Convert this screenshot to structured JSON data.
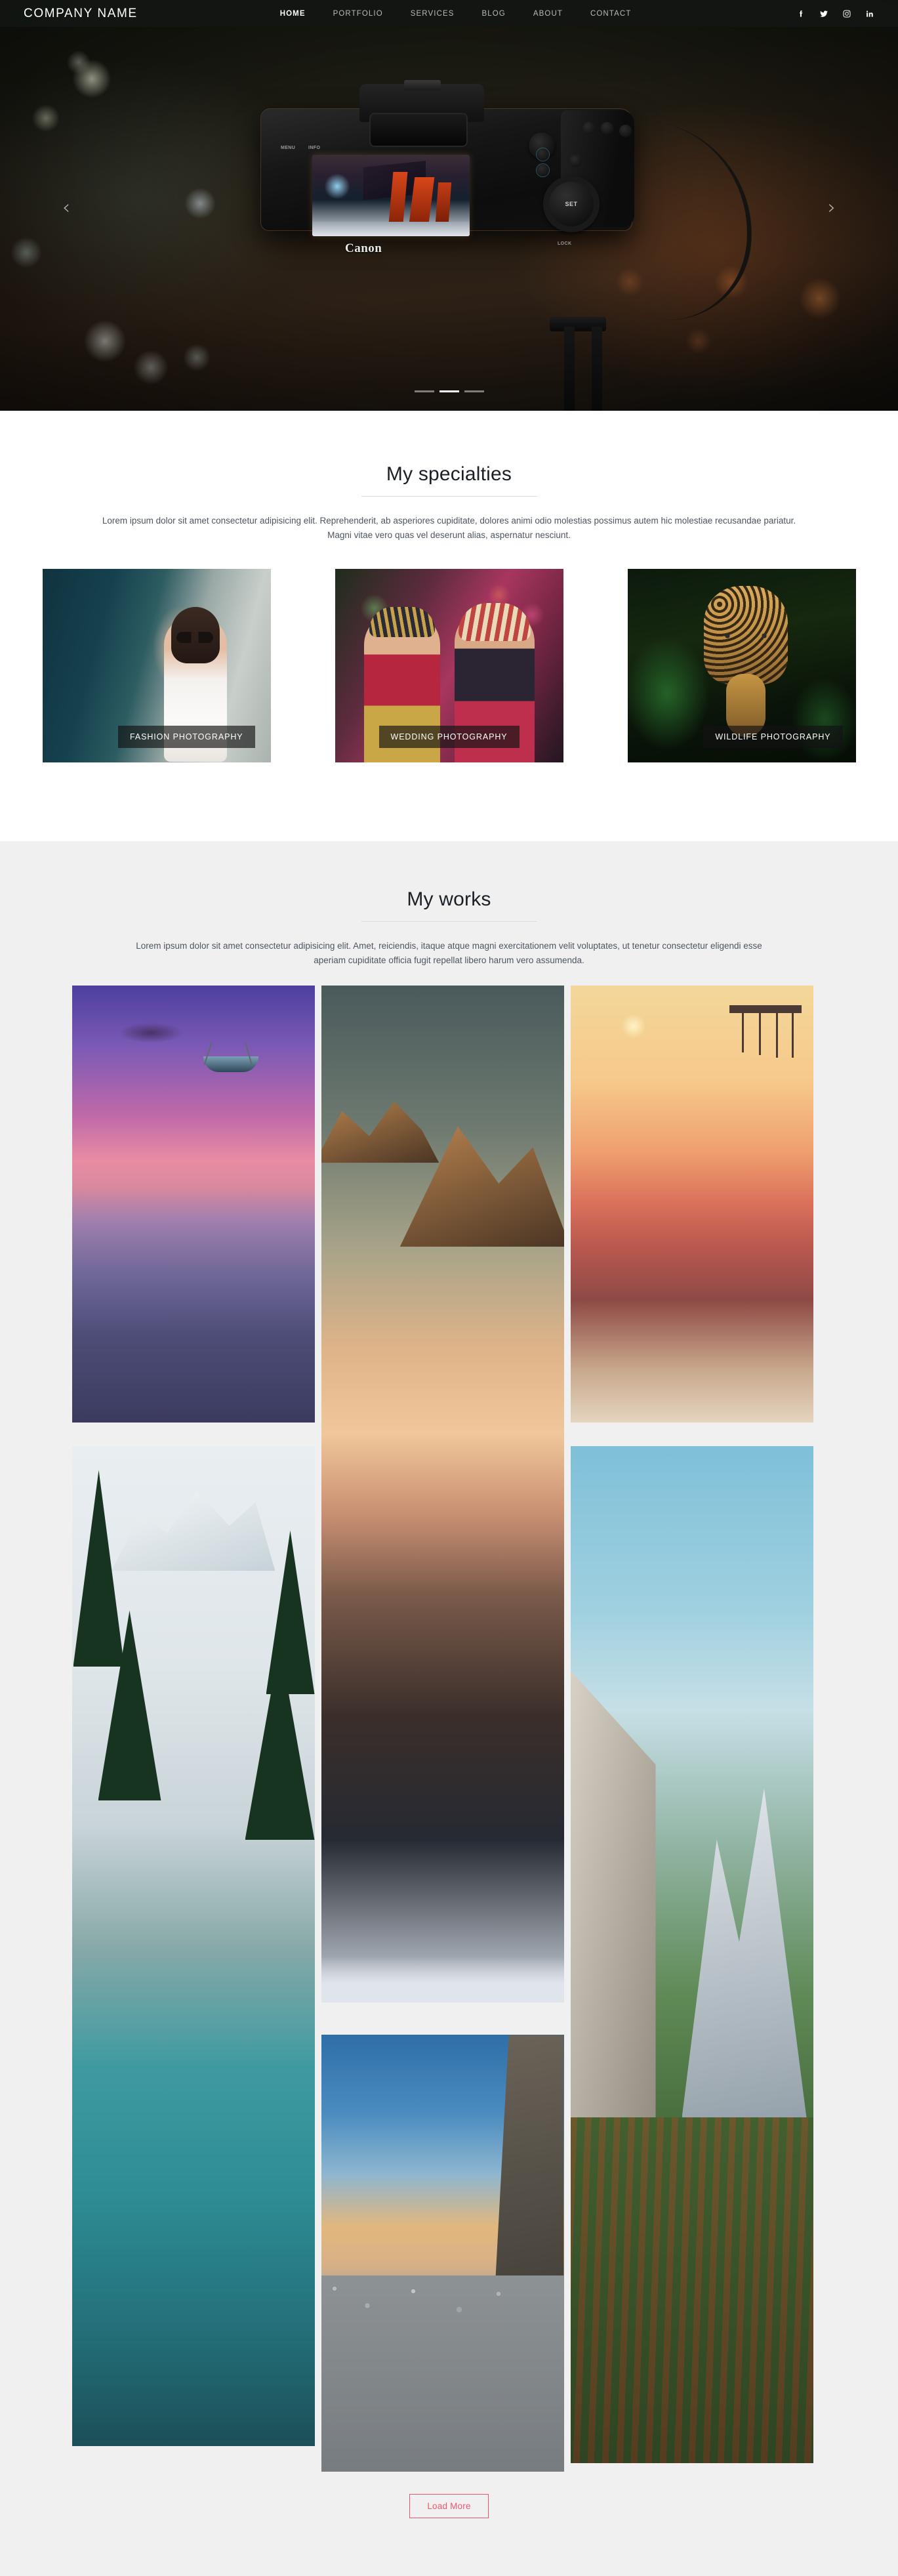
{
  "header": {
    "logo": "COMPANY NAME",
    "nav": [
      {
        "label": "HOME",
        "active": true
      },
      {
        "label": "PORTFOLIO",
        "active": false
      },
      {
        "label": "SERVICES",
        "active": false
      },
      {
        "label": "BLOG",
        "active": false
      },
      {
        "label": "ABOUT",
        "active": false
      },
      {
        "label": "CONTACT",
        "active": false
      }
    ],
    "social": [
      {
        "name": "facebook-icon"
      },
      {
        "name": "twitter-icon"
      },
      {
        "name": "instagram-icon"
      },
      {
        "name": "linkedin-icon"
      }
    ]
  },
  "hero": {
    "prev_label": "‹",
    "next_label": "›",
    "slide_count": 3,
    "active_slide": 2,
    "camera_brand": "Canon",
    "camera_labels": {
      "menu": "MENU",
      "info": "INFO",
      "set": "SET",
      "lock": "LOCK"
    }
  },
  "specialties": {
    "title": "My specialties",
    "description": "Lorem ipsum dolor sit amet consectetur adipisicing elit. Reprehenderit, ab asperiores cupiditate, dolores animi odio molestias possimus autem hic molestiae recusandae pariatur. Magni vitae vero quas vel deserunt alias, aspernatur nesciunt.",
    "cards": [
      {
        "caption": "FASHION PHOTOGRAPHY"
      },
      {
        "caption": "WEDDING PHOTOGRAPHY"
      },
      {
        "caption": "WILDLIFE PHOTOGRAPHY"
      }
    ]
  },
  "works": {
    "title": "My works",
    "description": "Lorem ipsum dolor sit amet consectetur adipisicing elit. Amet, reiciendis, itaque atque magni exercitationem velit voluptates, ut tenetur consectetur eligendi esse aperiam cupiditate officia fugit repellat libero harum vero assumenda.",
    "load_more": "Load More",
    "items": [
      {
        "name": "boat-at-sunset"
      },
      {
        "name": "mountain-range-above-clouds"
      },
      {
        "name": "pier-at-sunset"
      },
      {
        "name": "snowy-lake-with-pines"
      },
      {
        "name": "rocky-beach-at-dusk"
      },
      {
        "name": "yosemite-valley"
      }
    ]
  },
  "colors": {
    "accent": "#e8576f",
    "nav_bg": "#121612",
    "nav_link": "#b9bcb8",
    "nav_active": "#ffffff",
    "section_gray": "#f0f0f0",
    "heading": "#1b1f26",
    "body_text": "#4d5560"
  }
}
